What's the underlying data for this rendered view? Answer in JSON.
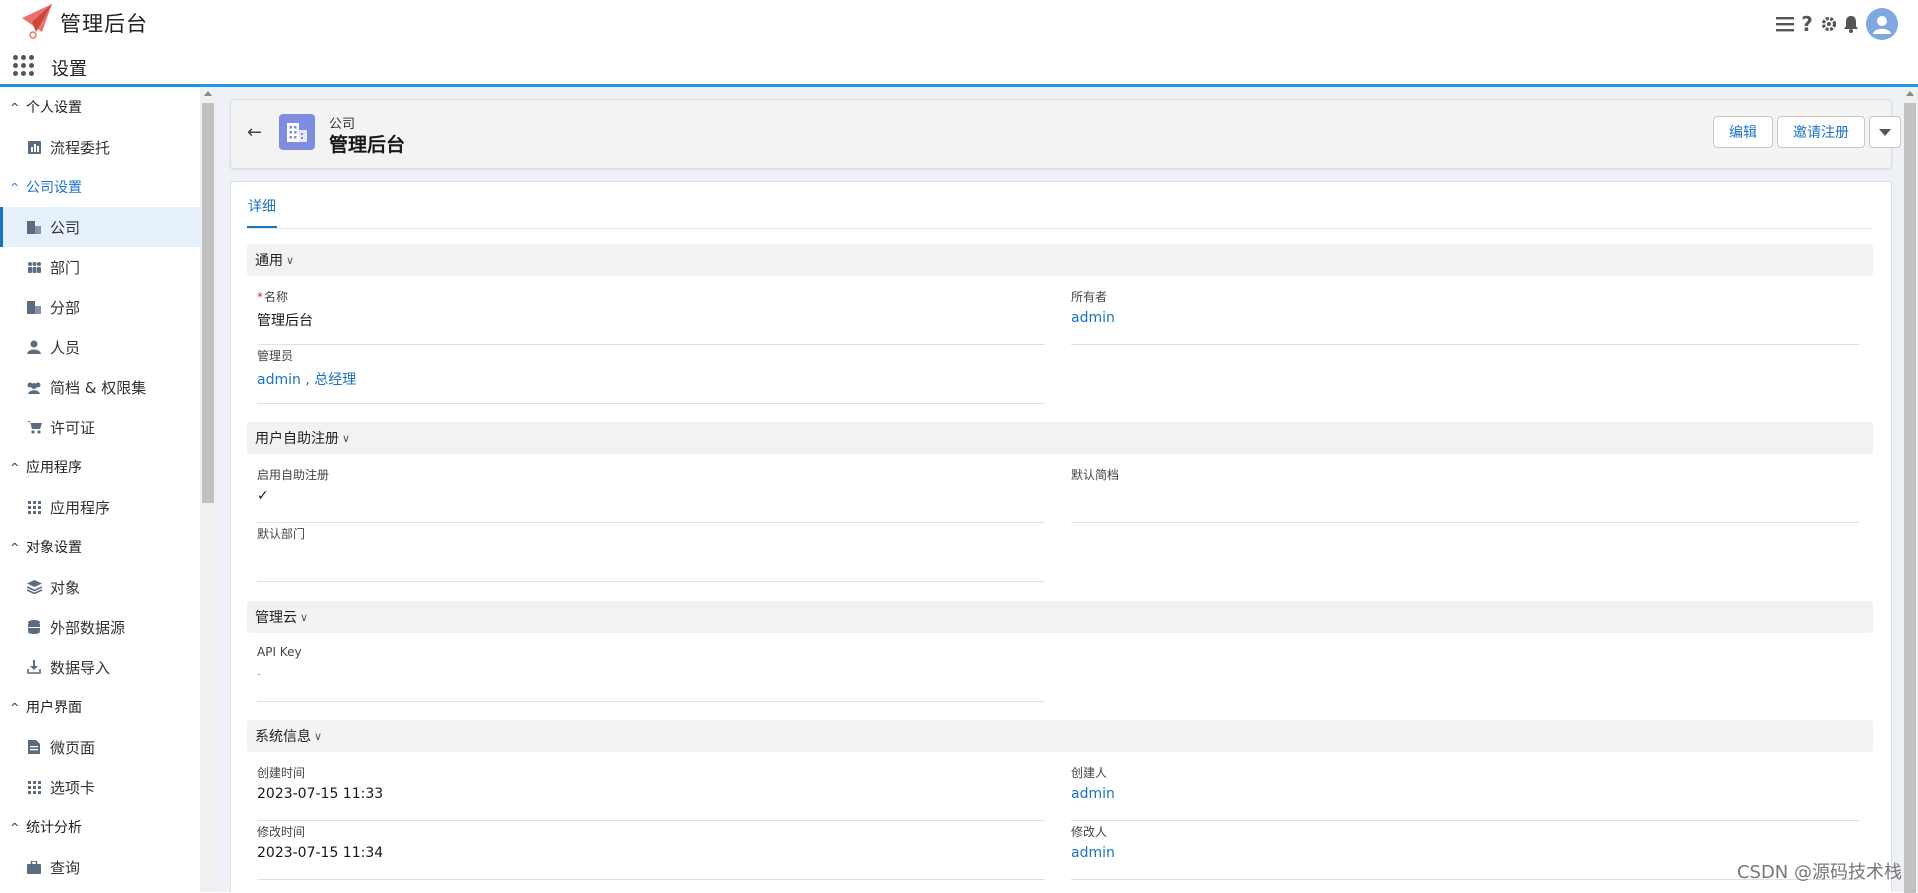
{
  "header": {
    "app_title": "管理后台",
    "icons": [
      "menu-icon",
      "help-icon",
      "gear-icon",
      "bell-icon",
      "user-avatar-icon"
    ],
    "accent_color": "#1b96e8"
  },
  "subheader": {
    "title": "设置"
  },
  "sidebar": {
    "groups": [
      {
        "label": "个人设置",
        "items": [
          {
            "label": "流程委托",
            "icon": "chart-icon"
          }
        ]
      },
      {
        "label": "公司设置",
        "active": true,
        "items": [
          {
            "label": "公司",
            "icon": "building-icon",
            "active": true
          },
          {
            "label": "部门",
            "icon": "team-icon"
          },
          {
            "label": "分部",
            "icon": "building-icon"
          },
          {
            "label": "人员",
            "icon": "person-icon"
          },
          {
            "label": "简档 & 权限集",
            "icon": "group-icon"
          },
          {
            "label": "许可证",
            "icon": "cart-icon"
          }
        ]
      },
      {
        "label": "应用程序",
        "items": [
          {
            "label": "应用程序",
            "icon": "grid-icon"
          }
        ]
      },
      {
        "label": "对象设置",
        "items": [
          {
            "label": "对象",
            "icon": "layers-icon"
          },
          {
            "label": "外部数据源",
            "icon": "database-icon"
          },
          {
            "label": "数据导入",
            "icon": "download-icon"
          }
        ]
      },
      {
        "label": "用户界面",
        "items": [
          {
            "label": "微页面",
            "icon": "document-icon"
          },
          {
            "label": "选项卡",
            "icon": "grid-icon"
          }
        ]
      },
      {
        "label": "统计分析",
        "items": [
          {
            "label": "查询",
            "icon": "briefcase-icon"
          }
        ]
      }
    ]
  },
  "record": {
    "type_label": "公司",
    "name": "管理后台",
    "buttons": {
      "edit": "编辑",
      "invite": "邀请注册"
    }
  },
  "tabs": {
    "detail": "详细"
  },
  "sections": {
    "general": {
      "title": "通用",
      "name_label": "名称",
      "name_value": "管理后台",
      "owner_label": "所有者",
      "owner_value": "admin",
      "admins_label": "管理员",
      "admins_value": "admin , 总经理"
    },
    "self_register": {
      "title": "用户自助注册",
      "enable_label": "启用自助注册",
      "enable_value": "✓",
      "default_profile_label": "默认简档",
      "default_dept_label": "默认部门"
    },
    "cloud": {
      "title": "管理云",
      "api_key_label": "API Key",
      "api_key_value": "-"
    },
    "system": {
      "title": "系统信息",
      "created_label": "创建时间",
      "created_value": "2023-07-15 11:33",
      "creator_label": "创建人",
      "creator_value": "admin",
      "modified_label": "修改时间",
      "modified_value": "2023-07-15 11:34",
      "modifier_label": "修改人",
      "modifier_value": "admin"
    }
  },
  "watermark": "CSDN @源码技术栈"
}
